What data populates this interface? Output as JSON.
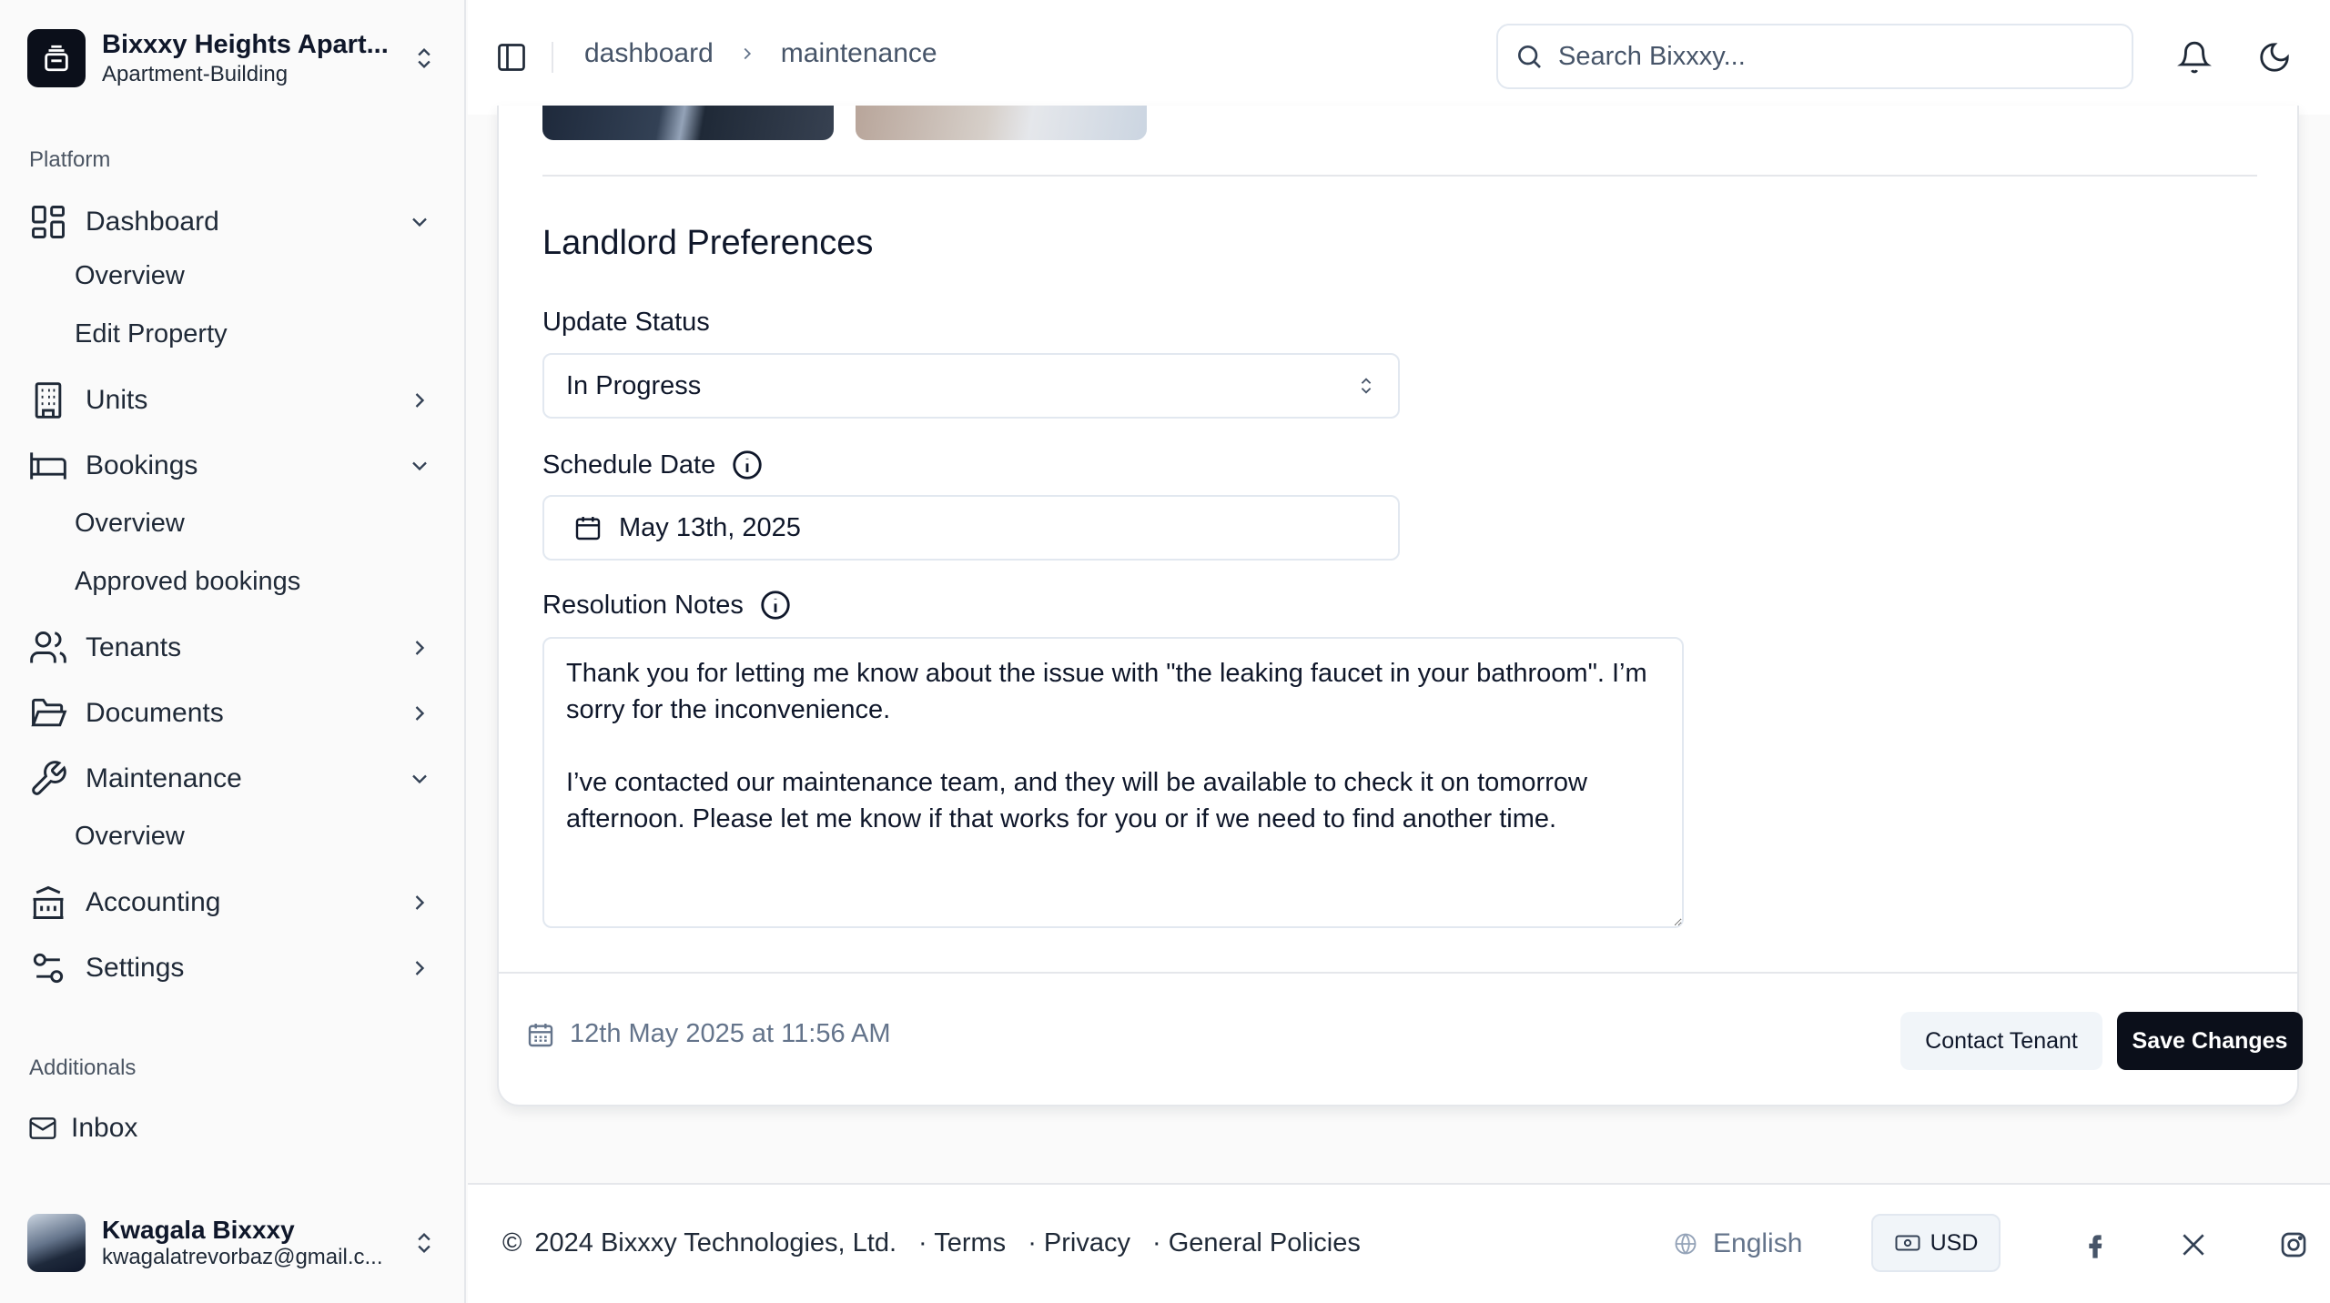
{
  "org": {
    "name": "Bixxxy Heights Apart...",
    "type": "Apartment-Building"
  },
  "sidebar": {
    "platform_label": "Platform",
    "additionals_label": "Additionals",
    "items": {
      "dashboard": "Dashboard",
      "dashboard_overview": "Overview",
      "dashboard_edit": "Edit Property",
      "units": "Units",
      "bookings": "Bookings",
      "bookings_overview": "Overview",
      "bookings_approved": "Approved bookings",
      "tenants": "Tenants",
      "documents": "Documents",
      "maintenance": "Maintenance",
      "maintenance_overview": "Overview",
      "accounting": "Accounting",
      "settings": "Settings",
      "inbox": "Inbox"
    }
  },
  "user": {
    "name": "Kwagala Bixxxy",
    "email": "kwagalatrevorbaz@gmail.c..."
  },
  "header": {
    "breadcrumb": [
      "dashboard",
      "maintenance"
    ],
    "search_placeholder": "Search Bixxxy..."
  },
  "main": {
    "section_title": "Landlord Preferences",
    "status_label": "Update Status",
    "status_value": "In Progress",
    "schedule_label": "Schedule Date",
    "schedule_value": "May 13th, 2025",
    "notes_label": "Resolution Notes",
    "notes_value": "Thank you for letting me know about the issue with \"the leaking faucet in your bathroom\". I’m sorry for the inconvenience.\n\nI’ve contacted our maintenance team, and they will be available to check it on tomorrow afternoon. Please let me know if that works for you or if we need to find another time.",
    "timestamp": "12th May 2025 at 11:56 AM",
    "contact_button": "Contact Tenant",
    "save_button": "Save Changes"
  },
  "footer": {
    "copyright_symbol": "©",
    "copyright": "2024 Bixxxy Technologies, Ltd.",
    "links": [
      "· Terms",
      "· Privacy",
      "· General Policies"
    ],
    "language": "English",
    "currency": "USD"
  },
  "colors": {
    "primary": "#0b0f1a",
    "border": "#e5e7eb",
    "muted_text": "#64748b"
  }
}
